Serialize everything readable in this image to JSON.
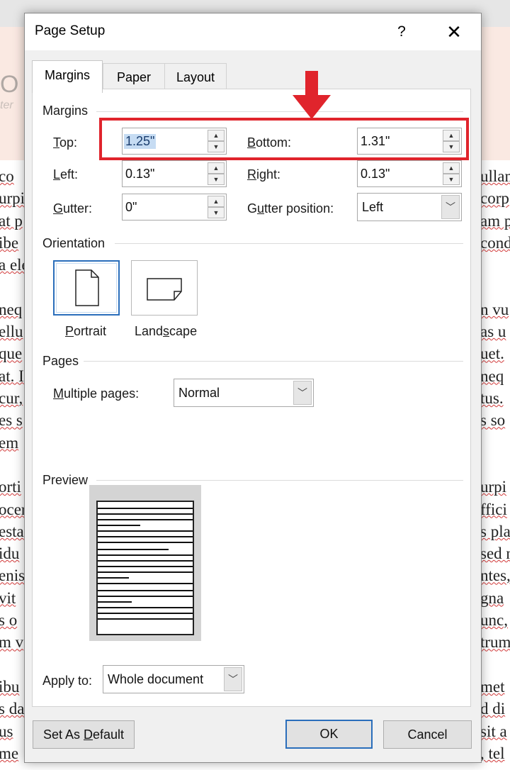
{
  "background_doc": {
    "logo_text": "O",
    "logo_subtext": "ter",
    "lines": [
      {
        "left": "co",
        "right": "ullam"
      },
      {
        "left": "urpi",
        "right": "corp"
      },
      {
        "left": "at p",
        "right": "am p"
      },
      {
        "left": "ibe",
        "right": "cond"
      },
      {
        "left": "a ele",
        "right": ""
      },
      {
        "left": "",
        "right": ""
      },
      {
        "left": "neq",
        "right": "n vu"
      },
      {
        "left": "ellu",
        "right": "as u"
      },
      {
        "left": "que",
        "right": "uet."
      },
      {
        "left": "at. I",
        "right": "neq"
      },
      {
        "left": "cur,",
        "right": "tus."
      },
      {
        "left": "es s",
        "right": "s so"
      },
      {
        "left": "em",
        "right": ""
      },
      {
        "left": "",
        "right": ""
      },
      {
        "left": "orti",
        "right": "urpi"
      },
      {
        "left": "ocer",
        "right": "ffici"
      },
      {
        "left": "esta",
        "right": "s pla"
      },
      {
        "left": "idu",
        "right": "sed n"
      },
      {
        "left": "enis",
        "right": "ntes,"
      },
      {
        "left": "vit",
        "right": "gna"
      },
      {
        "left": "s o",
        "right": "unc,"
      },
      {
        "left": "m v",
        "right": "trum"
      },
      {
        "left": "",
        "right": ""
      },
      {
        "left": "ibu",
        "right": "met"
      },
      {
        "left": "s da",
        "right": "d di"
      },
      {
        "left": "us",
        "right": "sit a"
      },
      {
        "left": "me",
        "right": ", tel"
      }
    ]
  },
  "dialog": {
    "title": "Page Setup",
    "help_label": "?",
    "close_label": "✕",
    "tabs": [
      {
        "label": "Margins",
        "active": true
      },
      {
        "label": "Paper",
        "active": false
      },
      {
        "label": "Layout",
        "active": false
      }
    ],
    "margins": {
      "group_label": "Margins",
      "top": {
        "label_u": "T",
        "label_rest": "op:",
        "value": "1.25\""
      },
      "bottom": {
        "label_u": "B",
        "label_rest": "ottom:",
        "value": "1.31\""
      },
      "left": {
        "label_u": "L",
        "label_rest": "eft:",
        "value": "0.13\""
      },
      "right": {
        "label_u": "R",
        "label_rest": "ight:",
        "value": "0.13\""
      },
      "gutter": {
        "label_u": "G",
        "label_rest": "utter:",
        "value": "0\""
      },
      "gutter_position": {
        "label_pre": "G",
        "label_u": "u",
        "label_rest": "tter position:",
        "value": "Left"
      }
    },
    "orientation": {
      "group_label": "Orientation",
      "portrait": {
        "label_u": "P",
        "label_rest": "ortrait",
        "selected": true
      },
      "landscape": {
        "label_pre": "Land",
        "label_u": "s",
        "label_rest": "cape",
        "selected": false
      }
    },
    "pages": {
      "group_label": "Pages",
      "multiple_pages": {
        "label_u": "M",
        "label_rest": "ultiple pages:",
        "value": "Normal"
      }
    },
    "preview": {
      "group_label": "Preview"
    },
    "apply_to": {
      "label_pre": "Apply to:",
      "value": "Whole document"
    },
    "buttons": {
      "set_default_pre": "Set As ",
      "set_default_u": "D",
      "set_default_rest": "efault",
      "ok": "OK",
      "cancel": "Cancel"
    }
  },
  "annotation": {
    "highlight_color": "#e0242c",
    "arrow_color": "#e0242c"
  }
}
